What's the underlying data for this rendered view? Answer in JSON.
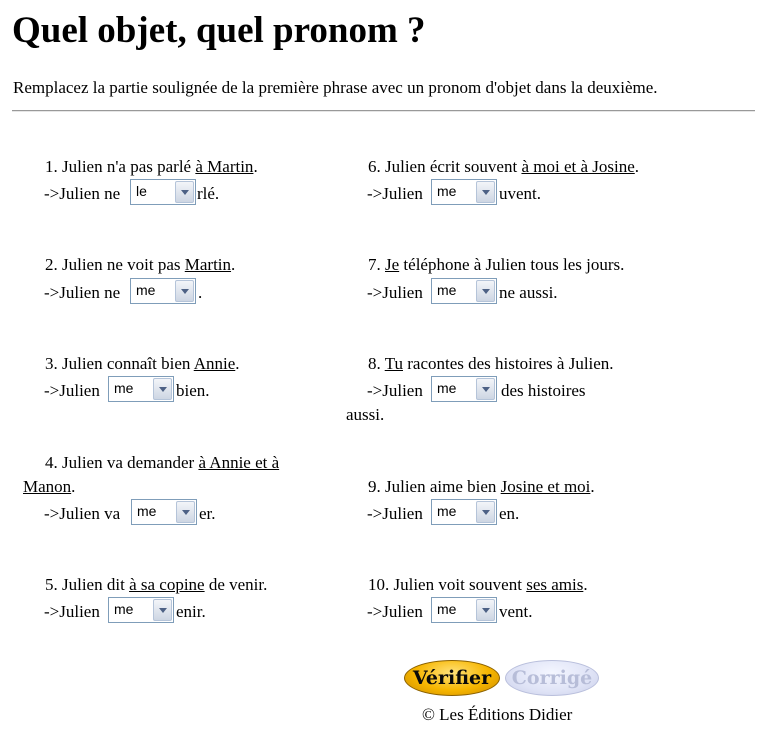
{
  "title": "Quel objet, quel pronom ?",
  "instructions": "Remplacez la partie soulignée de la première phrase avec un pronom d'objet dans la deuxième.",
  "exercises": [
    {
      "n": "1. ",
      "pre": "Julien n'a pas parlé ",
      "u": "à Martin",
      "post": ".",
      "ans_pre": "->Julien ne",
      "selected": "le",
      "ans_post": "rlé."
    },
    {
      "n": "2. ",
      "pre": "Julien ne voit pas ",
      "u": "Martin",
      "post": ".",
      "ans_pre": "->Julien ne",
      "selected": "me",
      "ans_post": "."
    },
    {
      "n": "3. ",
      "pre": "Julien connaît bien ",
      "u": "Annie",
      "post": ".",
      "ans_pre": "->Julien",
      "selected": "me",
      "ans_post": "bien."
    },
    {
      "n": "4. ",
      "pre": "Julien va demander ",
      "u": "à Annie et à",
      "u2": "Manon",
      "post": ".",
      "ans_pre": "->Julien va",
      "selected": "me",
      "ans_post": "er."
    },
    {
      "n": "5. ",
      "pre": "Julien dit ",
      "u": "à sa copine",
      "post": " de venir.",
      "ans_pre": "->Julien",
      "selected": "me",
      "ans_post": "enir."
    },
    {
      "n": "6. ",
      "pre": "Julien écrit souvent ",
      "u": "à moi et à Josine",
      "post": ".",
      "ans_pre": "->Julien",
      "selected": "me",
      "ans_post": "uvent."
    },
    {
      "n": "7. ",
      "pre": "",
      "u": "Je",
      "post": " téléphone à Julien tous les jours.",
      "ans_pre": "->Julien",
      "selected": "me",
      "ans_post": "ne aussi."
    },
    {
      "n": "8. ",
      "pre": "",
      "u": "Tu",
      "post": " racontes des histoires à Julien.",
      "ans_pre": "->Julien",
      "selected": "me",
      "ans_post": "des histoires",
      "ans_cont": "aussi."
    },
    {
      "n": "9. ",
      "pre": "Julien aime bien ",
      "u": "Josine et moi",
      "post": ".",
      "ans_pre": "->Julien",
      "selected": "me",
      "ans_post": "en."
    },
    {
      "n": "10. ",
      "pre": "Julien voit souvent ",
      "u": "ses amis",
      "post": ".",
      "ans_pre": "->Julien",
      "selected": "me",
      "ans_post": "vent."
    }
  ],
  "buttons": {
    "verify": "Vérifier",
    "corrige": "Corrigé"
  },
  "copyright": "© Les Éditions Didier"
}
